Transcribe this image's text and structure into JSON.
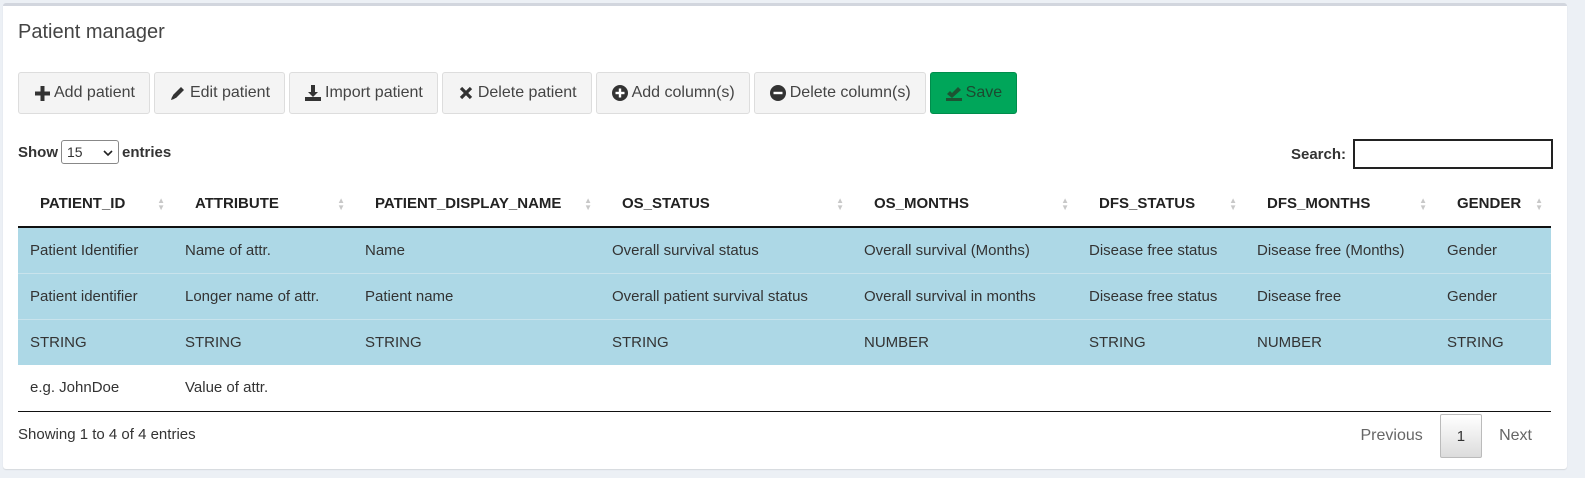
{
  "title": "Patient manager",
  "toolbar": {
    "buttons": [
      {
        "label": "Add patient",
        "icon": "plus-icon"
      },
      {
        "label": "Edit patient",
        "icon": "pencil-icon"
      },
      {
        "label": "Import patient",
        "icon": "download-icon"
      },
      {
        "label": "Delete patient",
        "icon": "times-icon"
      },
      {
        "label": "Add column(s)",
        "icon": "plus-circle-icon"
      },
      {
        "label": "Delete column(s)",
        "icon": "minus-circle-icon"
      },
      {
        "label": "Save",
        "icon": "save-icon"
      }
    ]
  },
  "length": {
    "prefix": "Show",
    "value": "15",
    "suffix": "entries"
  },
  "search": {
    "label": "Search:",
    "value": ""
  },
  "table": {
    "headers": [
      "PATIENT_ID",
      "ATTRIBUTE",
      "PATIENT_DISPLAY_NAME",
      "OS_STATUS",
      "OS_MONTHS",
      "DFS_STATUS",
      "DFS_MONTHS",
      "GENDER"
    ],
    "rows": [
      [
        "Patient Identifier",
        "Name of attr.",
        "Name",
        "Overall survival status",
        "Overall survival (Months)",
        "Disease free status",
        "Disease free (Months)",
        "Gender"
      ],
      [
        "Patient identifier",
        "Longer name of attr.",
        "Patient name",
        "Overall patient survival status",
        "Overall survival in months",
        "Disease free status",
        "Disease free",
        "Gender"
      ],
      [
        "STRING",
        "STRING",
        "STRING",
        "STRING",
        "NUMBER",
        "STRING",
        "NUMBER",
        "STRING"
      ],
      [
        "e.g. JohnDoe",
        "Value of attr.",
        "",
        "",
        "",
        "",
        "",
        ""
      ]
    ]
  },
  "info": "Showing 1 to 4 of 4 entries",
  "pagination": {
    "previous": "Previous",
    "current": "1",
    "next": "Next"
  },
  "colors": {
    "highlight_row": "#add8e6",
    "save_button": "#00a65a"
  }
}
